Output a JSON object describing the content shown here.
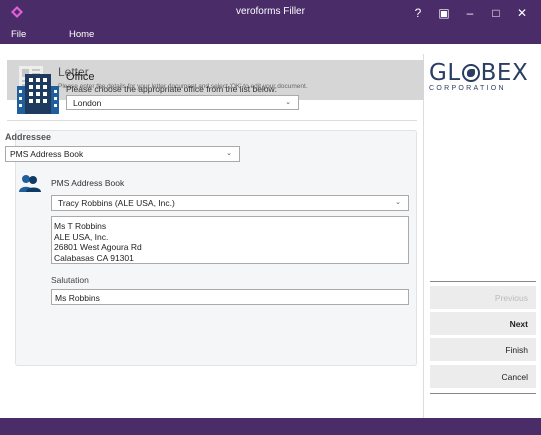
{
  "window": {
    "title": "veroforms Filler",
    "controls": [
      "?",
      "▣",
      "–",
      "□",
      "✕"
    ]
  },
  "menu": {
    "file": "File",
    "home": "Home"
  },
  "header": {
    "title": "Letter",
    "subtitle": "Please enter the details for your letter document and select 'OK' to edit your document."
  },
  "office": {
    "title": "Office",
    "prompt": "Please choose the appropriate office from the list below:",
    "selected": "London"
  },
  "addressee": {
    "label": "Addressee",
    "source_selected": "PMS Address Book",
    "book_label": "PMS Address Book",
    "contact_selected": "Tracy Robbins (ALE USA, Inc.)",
    "address_lines": [
      "Ms T Robbins",
      "ALE USA, Inc.",
      "26801 West Agoura Rd",
      "Calabasas CA 91301"
    ],
    "salutation_label": "Salutation",
    "salutation_value": "Ms Robbins"
  },
  "brand": {
    "logo_main_left": "GL",
    "logo_main_right": "BEX",
    "logo_sub": "CORPORATION",
    "color": "#2a3e62"
  },
  "nav": {
    "previous": "Previous",
    "next": "Next",
    "finish": "Finish",
    "cancel": "Cancel"
  },
  "colors": {
    "accent": "#4a2c69",
    "panel": "#f5f6f8",
    "header_band": "#d6d6d6"
  }
}
